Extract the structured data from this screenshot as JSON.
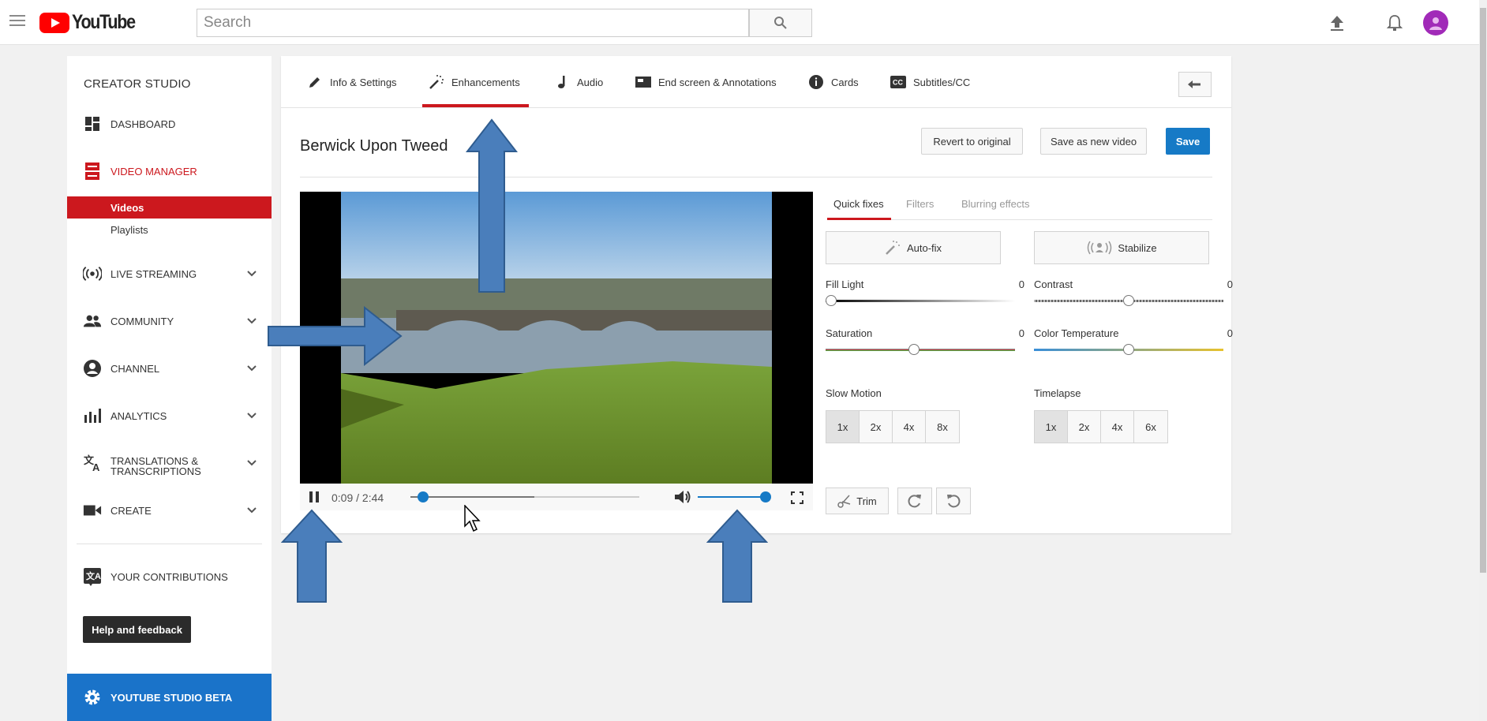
{
  "topbar": {
    "logo_text": "YouTube",
    "search_placeholder": "Search"
  },
  "sidebar": {
    "title": "CREATOR STUDIO",
    "items": [
      {
        "label": "DASHBOARD"
      },
      {
        "label": "VIDEO MANAGER"
      },
      {
        "label": "LIVE STREAMING"
      },
      {
        "label": "COMMUNITY"
      },
      {
        "label": "CHANNEL"
      },
      {
        "label": "ANALYTICS"
      },
      {
        "label": "TRANSLATIONS &"
      },
      {
        "label": "TRANSCRIPTIONS"
      },
      {
        "label": "CREATE"
      },
      {
        "label": "YOUR CONTRIBUTIONS"
      }
    ],
    "sub_items": [
      {
        "label": "Videos",
        "active": true
      },
      {
        "label": "Playlists",
        "active": false
      }
    ],
    "help_label": "Help and feedback",
    "beta_label": "YOUTUBE STUDIO BETA",
    "accent_color": "#cc181e"
  },
  "tabs": [
    {
      "label": "Info & Settings",
      "icon": "pencil-icon"
    },
    {
      "label": "Enhancements",
      "icon": "magic-wand-icon",
      "active": true
    },
    {
      "label": "Audio",
      "icon": "music-note-icon"
    },
    {
      "label": "End screen & Annotations",
      "icon": "end-screen-icon"
    },
    {
      "label": "Cards",
      "icon": "info-icon"
    },
    {
      "label": "Subtitles/CC",
      "icon": "cc-icon"
    }
  ],
  "video": {
    "title": "Berwick Upon Tweed",
    "time": "0:09 / 2:44",
    "progress_fraction": 0.055,
    "buffered_fraction": 0.54,
    "volume_fraction": 1.0
  },
  "actions": {
    "revert": "Revert to original",
    "save_new": "Save as new video",
    "save": "Save",
    "save_color": "#167ac6"
  },
  "editor": {
    "subtabs": [
      "Quick fixes",
      "Filters",
      "Blurring effects"
    ],
    "autofix": "Auto-fix",
    "stabilize": "Stabilize",
    "fill_light": {
      "label": "Fill Light",
      "value": "0"
    },
    "contrast": {
      "label": "Contrast",
      "value": "0"
    },
    "saturation": {
      "label": "Saturation",
      "value": "0"
    },
    "color_temperature": {
      "label": "Color Temperature",
      "value": "0"
    },
    "slow_motion": {
      "label": "Slow Motion",
      "options": [
        "1x",
        "2x",
        "4x",
        "8x"
      ],
      "selected": "1x"
    },
    "timelapse": {
      "label": "Timelapse",
      "options": [
        "1x",
        "2x",
        "4x",
        "6x"
      ],
      "selected": "1x"
    },
    "trim": "Trim"
  }
}
